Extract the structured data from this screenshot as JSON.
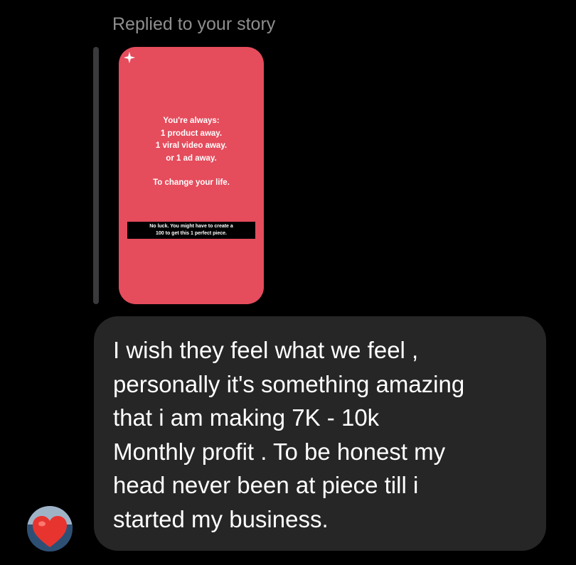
{
  "header": {
    "replied_label": "Replied to your story"
  },
  "story": {
    "background_color": "#e54c5c",
    "corner_icon": "sparkle-icon",
    "lines": [
      "You're always:",
      "1 product away.",
      "1 viral video away.",
      "or 1 ad away."
    ],
    "closing_line": "To change your life.",
    "note_lines": [
      "No luck. You might have to create a",
      "100 to get this 1 perfect piece."
    ]
  },
  "message": {
    "text": "I wish they feel what we feel ,\npersonally it's something amazing\nthat i am making 7K - 10k\nMonthly profit . To be honest my\nhead never been at piece till i\nstarted my business."
  },
  "sender": {
    "avatar_icon": "heart-icon",
    "heart_color": "#e8342f"
  }
}
